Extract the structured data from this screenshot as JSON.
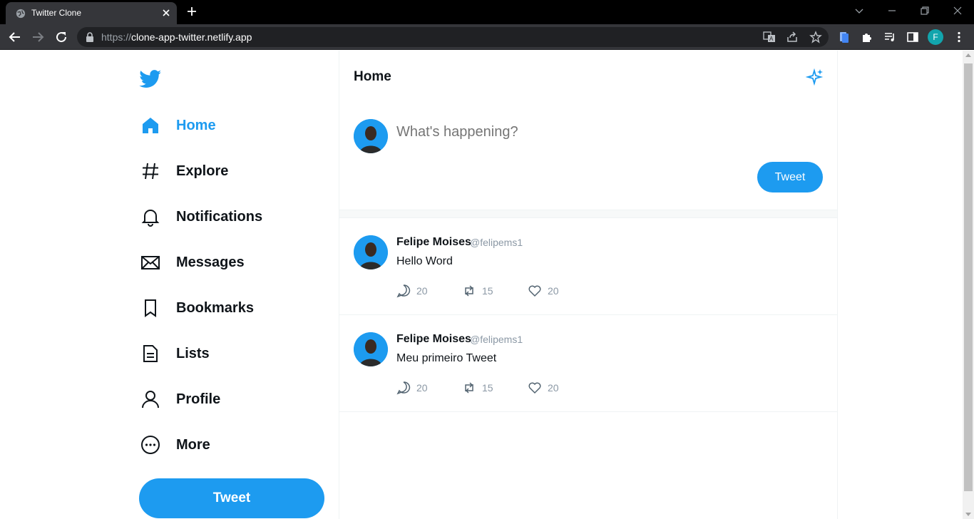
{
  "browser": {
    "tab_title": "Twitter Clone",
    "url_scheme": "https://",
    "url_host": "clone-app-twitter.netlify.app",
    "profile_initial": "F"
  },
  "sidebar": {
    "items": [
      {
        "label": "Home",
        "icon": "home-icon",
        "active": true
      },
      {
        "label": "Explore",
        "icon": "hashtag-icon"
      },
      {
        "label": "Notifications",
        "icon": "bell-icon"
      },
      {
        "label": "Messages",
        "icon": "envelope-icon"
      },
      {
        "label": "Bookmarks",
        "icon": "bookmark-icon"
      },
      {
        "label": "Lists",
        "icon": "list-icon"
      },
      {
        "label": "Profile",
        "icon": "user-icon"
      },
      {
        "label": "More",
        "icon": "more-icon"
      }
    ],
    "tweet_button": "Tweet"
  },
  "main": {
    "title": "Home",
    "composer": {
      "placeholder": "What's happening?",
      "button": "Tweet"
    },
    "posts": [
      {
        "name": "Felipe Moises",
        "handle": "@felipems1",
        "text": "Hello Word",
        "replies": "20",
        "retweets": "15",
        "likes": "20"
      },
      {
        "name": "Felipe Moises",
        "handle": "@felipems1",
        "text": "Meu primeiro Tweet",
        "replies": "20",
        "retweets": "15",
        "likes": "20"
      }
    ]
  },
  "colors": {
    "accent": "#1d9bf0",
    "chrome_dark": "#35363a"
  }
}
